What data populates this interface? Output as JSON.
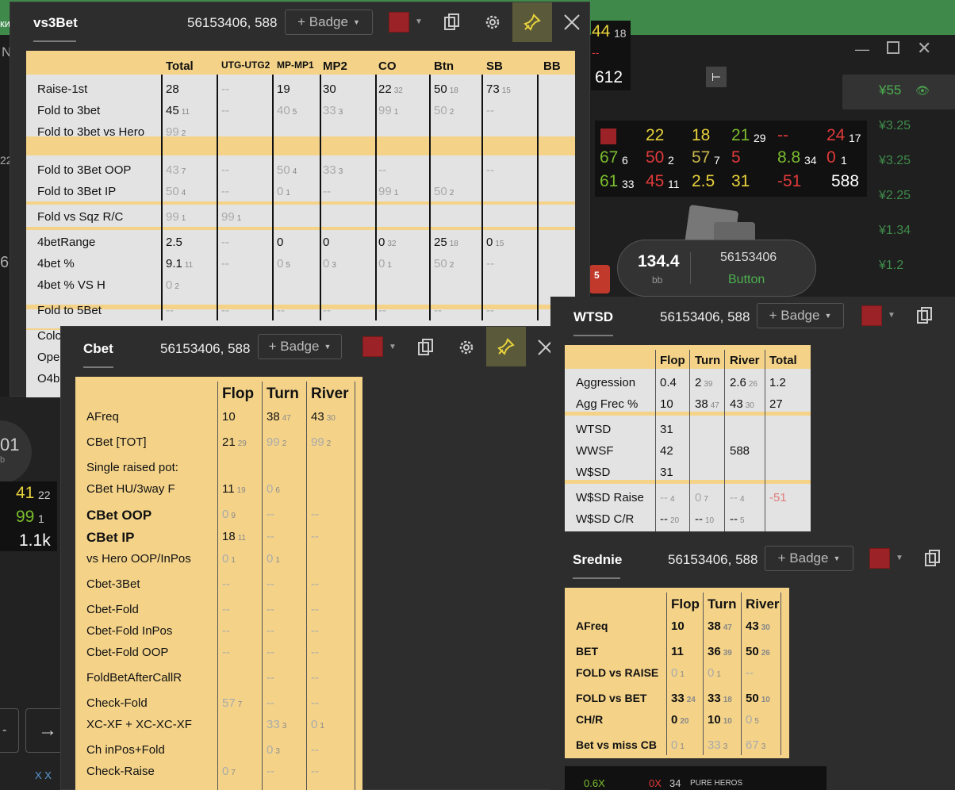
{
  "bg": {
    "greenbar_text": "ки",
    "left_text": "N",
    "left_num": "22",
    "left_num2": "6",
    "left_num3": "01",
    "left_small": "b",
    "rail_values": [
      "¥55",
      "¥3.25",
      "¥3.25",
      "¥2.25",
      "¥1.34",
      "¥1.2"
    ],
    "top_hud": [
      "44",
      "18",
      "--",
      "612"
    ],
    "left_hud": [
      "41",
      "22",
      "99",
      "1",
      "1.1k"
    ],
    "arrow": "→",
    "dash": "-",
    "bottom_hud": [
      "0.6X",
      "0X",
      "34",
      "PURE HEROS"
    ],
    "bottom_left": "X X"
  },
  "seat": {
    "stack": "134.4",
    "stack_unit": "bb",
    "id": "56153406",
    "position": "Button",
    "chips": "5"
  },
  "hud": {
    "r1": [
      "22",
      "18",
      "21",
      "29",
      "--",
      "24",
      "17"
    ],
    "r2": [
      "67",
      "6",
      "50",
      "2",
      "57",
      "7",
      "5",
      "8.8",
      "34",
      "0",
      "1"
    ],
    "r3": [
      "61",
      "33",
      "45",
      "11",
      "2.5",
      "31",
      "-51",
      "588"
    ]
  },
  "vs3bet": {
    "title": "vs3Bet",
    "id": "56153406, 588",
    "badge": "+ Badge",
    "cols": [
      "Total",
      "UTG-UTG2",
      "MP-MP1",
      "MP2",
      "CO",
      "Btn",
      "SB",
      "BB"
    ],
    "rows": [
      {
        "label": "Raise-1st",
        "vals": [
          [
            "28",
            ""
          ],
          [
            "--",
            ""
          ],
          [
            "19",
            ""
          ],
          [
            "30",
            ""
          ],
          [
            "22",
            "32"
          ],
          [
            "50",
            "18"
          ],
          [
            "73",
            "15"
          ],
          [
            "",
            ""
          ]
        ]
      },
      {
        "label": "Fold to 3bet",
        "vals": [
          [
            "45",
            "11"
          ],
          [
            "--",
            ""
          ],
          [
            "40",
            "5"
          ],
          [
            "33",
            "3"
          ],
          [
            "99",
            "1"
          ],
          [
            "50",
            "2"
          ],
          [
            "--",
            ""
          ],
          [
            "",
            ""
          ]
        ]
      },
      {
        "label": "Fold to 3bet vs Hero",
        "vals": [
          [
            "99",
            "2"
          ]
        ]
      },
      {
        "label": "Fold to 3Bet OOP",
        "vals": [
          [
            "43",
            "7"
          ],
          [
            "--",
            ""
          ],
          [
            "50",
            "4"
          ],
          [
            "33",
            "3"
          ],
          [
            "--",
            ""
          ],
          [
            "",
            ""
          ],
          [
            "--",
            ""
          ],
          [
            "",
            ""
          ]
        ]
      },
      {
        "label": "Fold to 3Bet IP",
        "vals": [
          [
            "50",
            "4"
          ],
          [
            "--",
            ""
          ],
          [
            "0",
            "1"
          ],
          [
            "--",
            ""
          ],
          [
            "99",
            "1"
          ],
          [
            "50",
            "2"
          ],
          [
            "",
            ""
          ],
          [
            "",
            ""
          ]
        ]
      },
      {
        "label": "Fold vs Sqz R/C",
        "vals": [
          [
            "99",
            "1"
          ],
          [
            "99",
            "1"
          ]
        ]
      },
      {
        "label": "4betRange",
        "vals": [
          [
            "2.5",
            ""
          ],
          [
            "--",
            ""
          ],
          [
            "0",
            ""
          ],
          [
            "0",
            ""
          ],
          [
            "0",
            "32"
          ],
          [
            "25",
            "18"
          ],
          [
            "0",
            "15"
          ],
          [
            "",
            ""
          ]
        ]
      },
      {
        "label": "4bet %",
        "vals": [
          [
            "9.1",
            "11"
          ],
          [
            "--",
            ""
          ],
          [
            "0",
            "5"
          ],
          [
            "0",
            "3"
          ],
          [
            "0",
            "1"
          ],
          [
            "50",
            "2"
          ],
          [
            "--",
            ""
          ],
          [
            "",
            ""
          ]
        ]
      },
      {
        "label": "4bet % VS H",
        "vals": [
          [
            "0",
            "2"
          ]
        ]
      },
      {
        "label": "Fold to 5Bet",
        "vals": [
          [
            "--",
            ""
          ],
          [
            "--",
            ""
          ],
          [
            "--",
            ""
          ],
          [
            "--",
            ""
          ],
          [
            "--",
            ""
          ],
          [
            "--",
            ""
          ],
          [
            "--",
            ""
          ],
          [
            "",
            ""
          ]
        ]
      },
      {
        "label": "Colc",
        "vals": []
      },
      {
        "label": "Ope",
        "vals": []
      },
      {
        "label": "O4b",
        "vals": []
      }
    ]
  },
  "cbet": {
    "title": "Cbet",
    "id": "56153406, 588",
    "badge": "+ Badge",
    "cols": [
      "Flop",
      "Turn",
      "River"
    ],
    "rows": [
      {
        "label": "AFreq",
        "vals": [
          [
            "10",
            ""
          ],
          [
            "38",
            "47"
          ],
          [
            "43",
            "30"
          ]
        ]
      },
      {
        "label": "CBet [TOT]",
        "vals": [
          [
            "21",
            "29"
          ],
          [
            "99",
            "2"
          ],
          [
            "99",
            "2"
          ]
        ]
      },
      {
        "label": "Single raised pot:",
        "vals": []
      },
      {
        "label": "CBet HU/3way F",
        "vals": [
          [
            "11",
            "19"
          ],
          [
            "0",
            "6"
          ],
          [
            "",
            ""
          ]
        ]
      },
      {
        "label": "CBet OOP",
        "vals": [
          [
            "0",
            "9"
          ],
          [
            "--",
            ""
          ],
          [
            "--",
            ""
          ]
        ]
      },
      {
        "label": "CBet IP",
        "vals": [
          [
            "18",
            "11"
          ],
          [
            "--",
            ""
          ],
          [
            "--",
            ""
          ]
        ]
      },
      {
        "label": "vs Hero OOP/InPos",
        "vals": [
          [
            "0",
            "1"
          ],
          [
            "0",
            "1"
          ],
          [
            "",
            ""
          ]
        ]
      },
      {
        "label": "Cbet-3Bet",
        "vals": [
          [
            "--",
            ""
          ],
          [
            "--",
            ""
          ],
          [
            "--",
            ""
          ]
        ]
      },
      {
        "label": "Cbet-Fold",
        "vals": [
          [
            "--",
            ""
          ],
          [
            "--",
            ""
          ],
          [
            "--",
            ""
          ]
        ]
      },
      {
        "label": "Cbet-Fold InPos",
        "vals": [
          [
            "--",
            ""
          ],
          [
            "--",
            ""
          ],
          [
            "--",
            ""
          ]
        ]
      },
      {
        "label": "Cbet-Fold OOP",
        "vals": [
          [
            "--",
            ""
          ],
          [
            "--",
            ""
          ],
          [
            "--",
            ""
          ]
        ]
      },
      {
        "label": "FoldBetAfterCallR",
        "vals": [
          [
            "",
            ""
          ],
          [
            "--",
            ""
          ],
          [
            "--",
            ""
          ]
        ]
      },
      {
        "label": "Check-Fold",
        "vals": [
          [
            "57",
            "7"
          ],
          [
            "--",
            ""
          ],
          [
            "--",
            ""
          ]
        ]
      },
      {
        "label": "XC-XF + XC-XC-XF",
        "vals": [
          [
            "",
            ""
          ],
          [
            "33",
            "3"
          ],
          [
            "0",
            "1"
          ]
        ]
      },
      {
        "label": "Ch inPos+Fold",
        "vals": [
          [
            "",
            ""
          ],
          [
            "0",
            "3"
          ],
          [
            "--",
            ""
          ]
        ]
      },
      {
        "label": "Check-Raise",
        "vals": [
          [
            "0",
            "7"
          ],
          [
            "--",
            ""
          ],
          [
            "--",
            ""
          ]
        ]
      }
    ]
  },
  "wtsd": {
    "title": "WTSD",
    "id": "56153406, 588",
    "badge": "+ Badge",
    "cols": [
      "Flop",
      "Turn",
      "River",
      "Total"
    ],
    "rows": [
      {
        "label": "Aggression",
        "vals": [
          [
            "0.4",
            ""
          ],
          [
            "2",
            "39"
          ],
          [
            "2.6",
            "26"
          ],
          [
            "1.2",
            ""
          ]
        ]
      },
      {
        "label": "Agg Frec %",
        "vals": [
          [
            "10",
            ""
          ],
          [
            "38",
            "47"
          ],
          [
            "43",
            "30"
          ],
          [
            "27",
            ""
          ]
        ]
      },
      {
        "label": "WTSD",
        "vals": [
          [
            "31",
            ""
          ]
        ]
      },
      {
        "label": "WWSF",
        "vals": [
          [
            "42",
            ""
          ],
          [
            "",
            ""
          ],
          [
            "588",
            ""
          ]
        ]
      },
      {
        "label": "W$SD",
        "vals": [
          [
            "31",
            ""
          ]
        ]
      },
      {
        "label": "W$SD Raise",
        "vals": [
          [
            "--",
            "4"
          ],
          [
            "0",
            "7"
          ],
          [
            "--",
            "4"
          ],
          [
            "-51",
            ""
          ]
        ]
      },
      {
        "label": "W$SD C/R",
        "vals": [
          [
            "--",
            "20"
          ],
          [
            "--",
            "10"
          ],
          [
            "--",
            "5"
          ]
        ]
      }
    ]
  },
  "srednie": {
    "title": "Srednie",
    "id": "56153406, 588",
    "badge": "+ Badge",
    "cols": [
      "Flop",
      "Turn",
      "River"
    ],
    "rows": [
      {
        "label": "AFreq",
        "vals": [
          [
            "10",
            ""
          ],
          [
            "38",
            "47"
          ],
          [
            "43",
            "30"
          ]
        ]
      },
      {
        "label": "BET",
        "vals": [
          [
            "11",
            ""
          ],
          [
            "36",
            "39"
          ],
          [
            "50",
            "26"
          ]
        ]
      },
      {
        "label": "FOLD vs RAISE",
        "vals": [
          [
            "0",
            "1"
          ],
          [
            "0",
            "1"
          ],
          [
            "--",
            ""
          ]
        ]
      },
      {
        "label": "FOLD vs BET",
        "vals": [
          [
            "33",
            "24"
          ],
          [
            "33",
            "18"
          ],
          [
            "50",
            "10"
          ]
        ]
      },
      {
        "label": "CH/R",
        "vals": [
          [
            "0",
            "20"
          ],
          [
            "10",
            "10"
          ],
          [
            "0",
            "5"
          ]
        ]
      },
      {
        "label": "Bet vs miss CB",
        "vals": [
          [
            "0",
            "1"
          ],
          [
            "33",
            "3"
          ],
          [
            "67",
            "3"
          ]
        ]
      }
    ]
  }
}
